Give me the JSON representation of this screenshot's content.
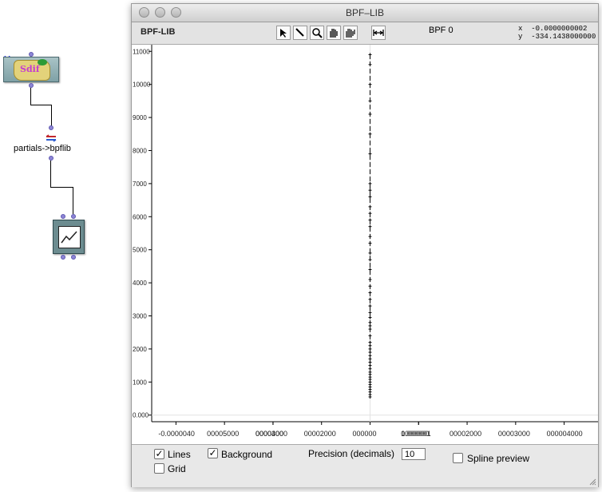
{
  "patch": {
    "close_glyph": "✕",
    "sdif_label": "Sdif",
    "converter_label": "partials->bpflib"
  },
  "window": {
    "title": "BPF–LIB",
    "toolbar": {
      "name": "BPF-LIB",
      "tools": [
        "arrow-select-icon",
        "pen-icon",
        "zoom-icon",
        "hand-icon",
        "hand-all-icon",
        "fit-view-icon"
      ],
      "bpf_name": "BPF 0",
      "x_label": "x",
      "x_value": "-0.0000000002",
      "y_label": "y",
      "y_value": "-334.1438000000"
    },
    "plot": {
      "y_ticks": [
        "11000",
        "10000",
        "9000",
        "8000",
        "7000",
        "6000",
        "5000",
        "4000",
        "3000",
        "2000",
        "1000",
        "0.000"
      ],
      "x_ticks": [
        "-0.000004",
        "-0.000003",
        "-0.000002",
        "-0.000002",
        "-0.000001",
        "0.000000",
        "0.000001",
        "0.000001",
        "0.000002",
        "0.000003",
        "0.000004"
      ],
      "x_tick_texts": [
        "-0.0000040",
        "00005000",
        "0000400",
        "00003000",
        "00002000",
        "000000",
        "1000000",
        "0.000001",
        "00002000",
        "00003000",
        "000004000"
      ]
    },
    "options": {
      "lines_label": "Lines",
      "lines_checked": true,
      "background_label": "Background",
      "background_checked": true,
      "grid_label": "Grid",
      "grid_checked": false,
      "precision_label": "Precision (decimals)",
      "precision_value": "10",
      "spline_label": "Spline preview",
      "spline_checked": false
    }
  },
  "chart_data": {
    "type": "scatter",
    "title": "",
    "xlabel": "",
    "ylabel": "",
    "xlim": [
      -4.5e-06,
      4.5e-06
    ],
    "ylim": [
      -200,
      11200
    ],
    "x": [
      0,
      0,
      0,
      0,
      0,
      0,
      0,
      0,
      0,
      0,
      0,
      0,
      0,
      0,
      0,
      0,
      0,
      0,
      0,
      0,
      0,
      0,
      0,
      0,
      0,
      0,
      0,
      0,
      0,
      0,
      0,
      0,
      0,
      0,
      0,
      0,
      0,
      0,
      0,
      0,
      0,
      0,
      0,
      0,
      0,
      0,
      0,
      0,
      0,
      0
    ],
    "y": [
      550,
      620,
      700,
      780,
      850,
      920,
      1000,
      1080,
      1150,
      1230,
      1300,
      1400,
      1500,
      1600,
      1700,
      1800,
      1900,
      2000,
      2100,
      2200,
      2400,
      2600,
      2700,
      2800,
      2950,
      3100,
      3300,
      3500,
      3700,
      3900,
      4100,
      4400,
      4700,
      4900,
      5200,
      5400,
      5700,
      5900,
      6100,
      6300,
      6600,
      6800,
      7000,
      7900,
      8500,
      9100,
      9500,
      10000,
      10600,
      10900
    ],
    "grid": false,
    "point_color": "#000000"
  }
}
